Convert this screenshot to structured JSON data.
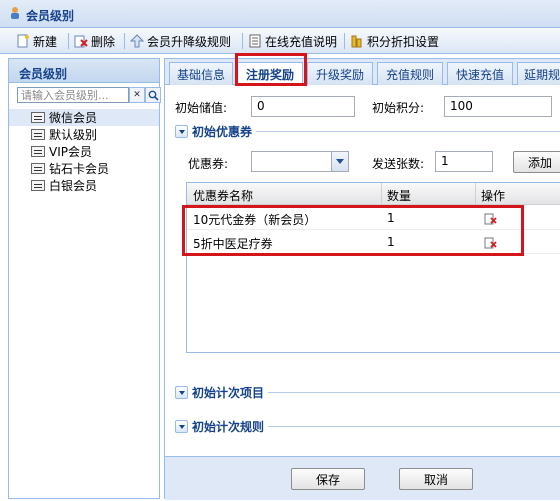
{
  "window": {
    "title": "会员级别"
  },
  "toolbar": {
    "new": "新建",
    "delete": "删除",
    "upgrade_rules": "会员升降级规则",
    "recharge_info": "在线充值说明",
    "points_discount": "积分折扣设置"
  },
  "sidebar": {
    "title": "会员级别",
    "search_placeholder": "请输入会员级别...",
    "items": [
      {
        "label": "微信会员",
        "selected": true
      },
      {
        "label": "默认级别"
      },
      {
        "label": "VIP会员"
      },
      {
        "label": "钻石卡会员"
      },
      {
        "label": "白银会员"
      }
    ]
  },
  "tabs": [
    {
      "label": "基础信息"
    },
    {
      "label": "注册奖励",
      "active": true
    },
    {
      "label": "升级奖励"
    },
    {
      "label": "充值规则"
    },
    {
      "label": "快速充值"
    },
    {
      "label": "延期规"
    }
  ],
  "form": {
    "initial_balance_label": "初始储值:",
    "initial_balance_value": "0",
    "initial_points_label": "初始积分:",
    "initial_points_value": "100"
  },
  "coupons": {
    "section_title": "初始优惠券",
    "coupon_label": "优惠券:",
    "coupon_value": "",
    "send_count_label": "发送张数:",
    "send_count_value": "1",
    "add_button": "添加",
    "columns": [
      "优惠券名称",
      "数量",
      "操作"
    ],
    "rows": [
      {
        "name": "10元代金券（新会员）",
        "qty": "1"
      },
      {
        "name": "5折中医足疗券",
        "qty": "1"
      }
    ]
  },
  "sections": {
    "count_items": "初始计次项目",
    "count_rules": "初始计次规则"
  },
  "buttons": {
    "save": "保存",
    "cancel": "取消"
  },
  "colors": {
    "accent": "#15428b",
    "highlight": "#d4161c",
    "panel": "#dfe8f6"
  }
}
